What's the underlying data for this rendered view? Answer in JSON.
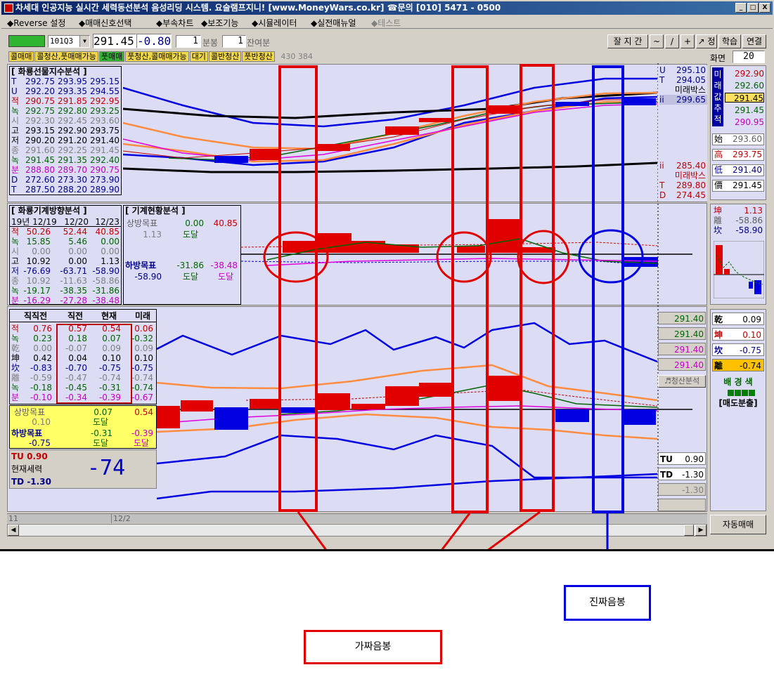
{
  "window": {
    "title": "차세대 인공지능 실시간 세력동선분석 음성리딩 시스템. 요술램프지니! [www.MoneyWars.co.kr] ☎문의 [010] 5471 - 0500",
    "min": "_",
    "max": "□",
    "close": "X"
  },
  "menu": [
    {
      "label": "◆Reverse 설정",
      "dis": false
    },
    {
      "label": "◆매매신호선택",
      "dis": false
    },
    {
      "label": "◆부속차트",
      "dis": false
    },
    {
      "label": "◆보조기능",
      "dis": false
    },
    {
      "label": "◆시뮬레이터",
      "dis": false
    },
    {
      "label": "◆실전매뉴얼",
      "dis": false
    },
    {
      "label": "◆테스트",
      "dis": true
    }
  ],
  "toolbar": {
    "code": "101Q3",
    "price": "291.45",
    "change": "-0.80",
    "period_val": "1",
    "period_unit": "분봉",
    "rem_val": "1",
    "rem_unit": "잔여분",
    "btn_tools": "잘 지 간",
    "btn_t1": "~",
    "btn_t2": "/",
    "btn_t3": "+",
    "btn_t4": "↗ 정",
    "btn_learn": "학습",
    "btn_link": "연결",
    "screen_label": "화면",
    "screen_val": "20"
  },
  "tabs": [
    "콜매매",
    "콜청산,풋매매가능",
    "풋매매",
    "풋청산,콜매매가능",
    "대기",
    "콜반청산",
    "풋반청산"
  ],
  "tabs_extra": "430 384",
  "panel1": {
    "title": "[ 화룡선물지수분석 ]",
    "rows": [
      {
        "k": "T",
        "a": "292.75",
        "b": "293.95",
        "c": "295.15",
        "col": "#00008b"
      },
      {
        "k": "U",
        "a": "292.20",
        "b": "293.35",
        "c": "294.55",
        "col": "#00008b"
      },
      {
        "k": "적",
        "a": "290.75",
        "b": "291.85",
        "c": "292.95",
        "col": "#c00000"
      },
      {
        "k": "녹",
        "a": "292.75",
        "b": "292.80",
        "c": "293.25",
        "col": "#006400"
      },
      {
        "k": "시",
        "a": "292.30",
        "b": "292.45",
        "c": "293.60",
        "col": "#808080"
      },
      {
        "k": "고",
        "a": "293.15",
        "b": "292.90",
        "c": "293.75",
        "col": "#000"
      },
      {
        "k": "저",
        "a": "290.20",
        "b": "291.20",
        "c": "291.40",
        "col": "#000"
      },
      {
        "k": "종",
        "a": "291.60",
        "b": "292.25",
        "c": "291.45",
        "col": "#808080"
      },
      {
        "k": "녹",
        "a": "291.45",
        "b": "291.35",
        "c": "292.40",
        "col": "#006400"
      },
      {
        "k": "분",
        "a": "288.80",
        "b": "289.70",
        "c": "290.75",
        "col": "#c000c0"
      },
      {
        "k": "D",
        "a": "272.60",
        "b": "273.30",
        "c": "273.90",
        "col": "#00008b"
      },
      {
        "k": "T",
        "a": "287.50",
        "b": "288.20",
        "c": "289.90",
        "col": "#00008b"
      }
    ]
  },
  "axis1": {
    "U": "295.10",
    "T": "294.05",
    "mirae": "미래박스",
    "ii": "299.65",
    "ii2": "285.40",
    "mirae2": "미래박스",
    "T2": "289.80",
    "D": "274.45"
  },
  "side1": {
    "v1": "292.90",
    "v2": "292.60",
    "v3": "291.45",
    "v4": "291.45",
    "v5": "290.95",
    "labels": [
      "미",
      "래",
      "값",
      "추",
      "적"
    ],
    "s_l": "始",
    "s_v": "293.60",
    "h_l": "高",
    "h_v": "293.75",
    "lo_l": "低",
    "lo_v": "291.40",
    "c_l": "價",
    "c_v": "291.45"
  },
  "panel2": {
    "title": "[ 화룡기계방향분석 ]",
    "hdr": [
      "19년 12/19",
      "12/20",
      "12/23"
    ],
    "rows": [
      {
        "k": "적",
        "a": "50.26",
        "b": "52.44",
        "c": "40.85",
        "col": "#c00000"
      },
      {
        "k": "녹",
        "a": "15.85",
        "b": "5.46",
        "c": "0.00",
        "col": "#006400"
      },
      {
        "k": "시",
        "a": "0.00",
        "b": "0.00",
        "c": "0.00",
        "col": "#808080"
      },
      {
        "k": "고",
        "a": "10.92",
        "b": "0.00",
        "c": "1.13",
        "col": "#000"
      },
      {
        "k": "저",
        "a": "-76.69",
        "b": "-63.71",
        "c": "-58.90",
        "col": "#00008b"
      },
      {
        "k": "종",
        "a": "10.92",
        "b": "-11.63",
        "c": "-58.86",
        "col": "#808080"
      },
      {
        "k": "녹",
        "a": "-19.17",
        "b": "-38.35",
        "c": "-31.86",
        "col": "#006400"
      },
      {
        "k": "분",
        "a": "-16.29",
        "b": "-27.28",
        "c": "-38.48",
        "col": "#c000c0"
      }
    ]
  },
  "panel2b": {
    "title": "[ 기계현황분석 ]",
    "up_label": "상방목표",
    "up_a": "0.00",
    "up_b": "40.85",
    "up_sub": "1.13",
    "up_reach": "도달",
    "dn_label": "하방목표",
    "dn_a": "-31.86",
    "dn_b": "-38.48",
    "dn_sub": "-58.90",
    "dn_reach1": "도달",
    "dn_reach2": "도달"
  },
  "side2": {
    "k": "坤",
    "v": "1.13",
    "r1_l": "離",
    "r1_v": "-58.86",
    "r2_l": "坎",
    "r2_v": "-58.90"
  },
  "panel3": {
    "hdr": [
      "직직전",
      "직전",
      "현재",
      "미래"
    ],
    "rows": [
      {
        "k": "적",
        "a": "0.76",
        "b": "0.57",
        "c": "0.54",
        "d": "0.06",
        "col": "#c00000"
      },
      {
        "k": "녹",
        "a": "0.23",
        "b": "0.18",
        "c": "0.07",
        "d": "-0.32",
        "col": "#006400"
      },
      {
        "k": "乾",
        "a": "0.00",
        "b": "-0.07",
        "c": "0.09",
        "d": "0.09",
        "col": "#808080"
      },
      {
        "k": "坤",
        "a": "0.42",
        "b": "0.04",
        "c": "0.10",
        "d": "0.10",
        "col": "#000"
      },
      {
        "k": "坎",
        "a": "-0.83",
        "b": "-0.70",
        "c": "-0.75",
        "d": "-0.75",
        "col": "#00008b"
      },
      {
        "k": "離",
        "a": "-0.59",
        "b": "-0.47",
        "c": "-0.74",
        "d": "-0.74",
        "col": "#808080"
      },
      {
        "k": "녹",
        "a": "-0.18",
        "b": "-0.45",
        "c": "-0.31",
        "d": "-0.74",
        "col": "#006400"
      },
      {
        "k": "분",
        "a": "-0.10",
        "b": "-0.34",
        "c": "-0.39",
        "d": "-0.67",
        "col": "#c000c0"
      }
    ],
    "up_label": "상방목표",
    "up_sub": "0.10",
    "up_a": "0.07",
    "up_reach": "도달",
    "up_b": "0.54",
    "dn_label": "하방목표",
    "dn_sub": "-0.75",
    "dn_a": "-0.31",
    "dn_reach": "도달",
    "dn_b": "-0.39",
    "dn_reach2": "도달",
    "tu": "TU  0.90",
    "power_label": "현재세력",
    "power_val": "-74",
    "td": "TD -1.30"
  },
  "axis3": {
    "v1": "291.40",
    "v2": "291.40",
    "v3": "291.40",
    "v4": "291.40",
    "btn": "♬청산분석",
    "tu": "TU",
    "tu_v": "0.90",
    "td": "TD",
    "td_v": "-1.30",
    "last": "-1.30"
  },
  "side3": {
    "r1_l": "乾",
    "r1_v": "0.09",
    "r2_l": "坤",
    "r2_v": "0.10",
    "r3_l": "坎",
    "r3_v": "-0.75",
    "r4_l": "離",
    "r4_v": "-0.74",
    "bg_label": "배 경 색",
    "sell": "[매도분출]"
  },
  "xaxis": {
    "l1": "11",
    "l2": "12/2"
  },
  "auto_btn": "자동매매",
  "annot": {
    "fake": "가짜음봉",
    "real": "진짜음봉"
  }
}
